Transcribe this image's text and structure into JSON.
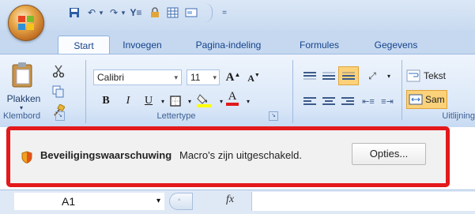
{
  "tabs": [
    {
      "label": "Start"
    },
    {
      "label": "Invoegen"
    },
    {
      "label": "Pagina-indeling"
    },
    {
      "label": "Formules"
    },
    {
      "label": "Gegevens"
    }
  ],
  "clipboard": {
    "paste_label": "Plakken",
    "group_label": "Klembord"
  },
  "font": {
    "name": "Calibri",
    "size": "11",
    "bold": "B",
    "italic": "I",
    "underline": "U",
    "grow": "A",
    "shrink": "A",
    "color_letter": "A",
    "group_label": "Lettertype"
  },
  "alignment": {
    "group_label": "Uitlijning",
    "wrap_label": "Tekst",
    "merge_label": "Sam"
  },
  "security": {
    "title": "Beveiligingswaarschuwing",
    "message": "Macro's zijn uitgeschakeld.",
    "options_label": "Opties..."
  },
  "formula_bar": {
    "cell_ref": "A1",
    "fx_label": "fx"
  },
  "colors": {
    "highlight_frame": "#e3191b",
    "ribbon_text": "#15428b"
  }
}
